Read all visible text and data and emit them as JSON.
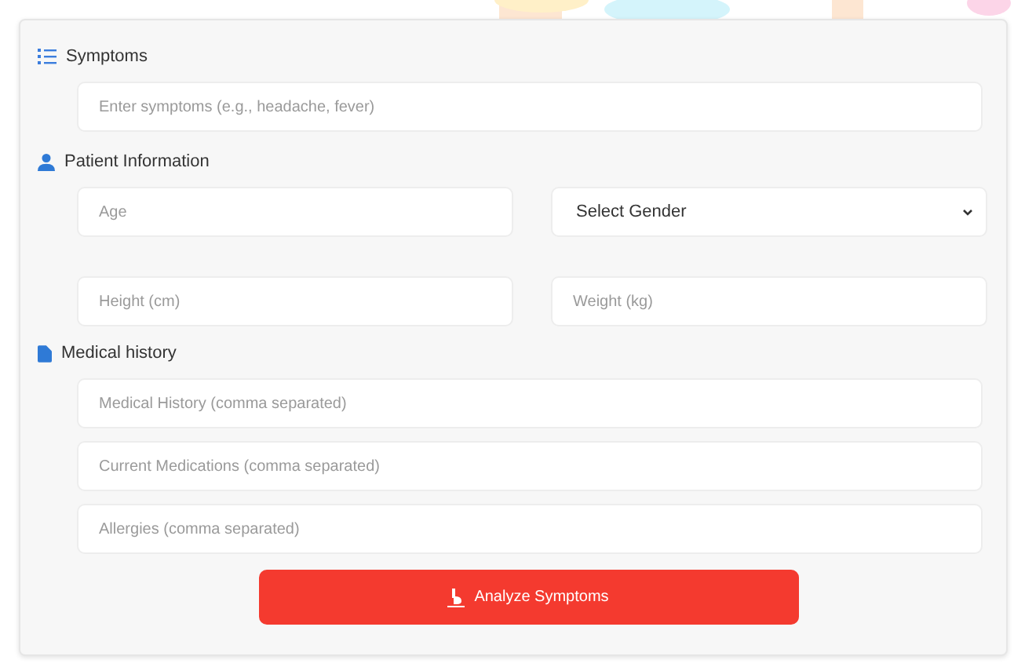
{
  "sections": [
    {
      "title": "Symptoms",
      "kind": "stack",
      "fields": [
        {
          "kind": "input",
          "placeholder": "Enter symptoms (e.g., headache, fever)"
        }
      ]
    },
    {
      "title": "Patient Information",
      "kind": "grid",
      "fields": [
        {
          "kind": "input",
          "placeholder": "Age"
        },
        {
          "kind": "select",
          "value": "Select Gender"
        },
        {
          "kind": "input",
          "placeholder": "Height (cm)"
        },
        {
          "kind": "input",
          "placeholder": "Weight (kg)"
        }
      ]
    },
    {
      "title": "Medical history",
      "kind": "stack",
      "fields": [
        {
          "kind": "input",
          "placeholder": "Medical History (comma separated)"
        },
        {
          "kind": "input",
          "placeholder": "Current Medications (comma separated)"
        },
        {
          "kind": "input",
          "placeholder": "Allergies (comma separated)"
        }
      ]
    }
  ],
  "submit": {
    "label": "Analyze Symptoms"
  }
}
